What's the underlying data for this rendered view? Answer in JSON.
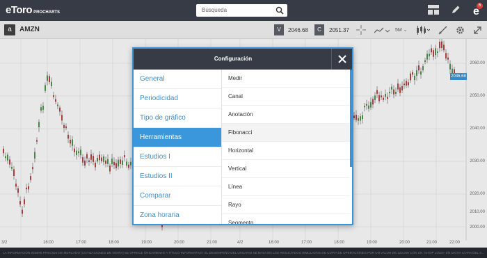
{
  "app": {
    "logo": "eToro",
    "logo_sub": "PROCHARTS"
  },
  "search": {
    "placeholder": "Búsqueda"
  },
  "notifications": {
    "count": "6"
  },
  "symbol": {
    "badge": "a",
    "name": "AMZN",
    "bid_label": "V",
    "bid": "2046.68",
    "ask_label": "C",
    "ask": "2051.37",
    "interval": "5M"
  },
  "chart": {
    "y_labels": [
      "2060.00",
      "2050.00",
      "2040.00",
      "2030.00",
      "2020.00",
      "2010.00",
      "2000.00"
    ],
    "price_tag": "2046.68",
    "x_labels": [
      "3/2",
      "16:00",
      "17:00",
      "18:00",
      "19:00",
      "20:00",
      "21:00",
      "4/2",
      "16:00",
      "17:00",
      "18:00",
      "19:00",
      "20:00",
      "21:00",
      "22:00"
    ]
  },
  "footer": {
    "disclaimer": "LA INFORMACIÓN SOBRE PRECIOS DE MERCADO (COTIZACIONES DE VENTA) SE OFRECE ÚNICAMENTE A TÍTULO INFORMATIVO. EL DESEMPEÑO DEL USUARIO SE BASA EN LOS RESULTADOS SIMULADOS DE COPIA DE OPERACIONES POR UN VALOR DE 122,000 CON UN «STOP LOSS» EN DICHA COPIA DEL 4..."
  },
  "modal": {
    "title": "Configuración",
    "categories": [
      "General",
      "Periodicidad",
      "Tipo de gráfico",
      "Herramientas",
      "Estudios I",
      "Estudios II",
      "Comparar",
      "Zona horaria"
    ],
    "tools": [
      "Medir",
      "Canal",
      "Anotación",
      "Fibonacci",
      "Horizontal",
      "Vertical",
      "Línea",
      "Rayo",
      "Segmento"
    ]
  },
  "colors": {
    "accent": "#3b97dc",
    "bull": "#4a8c4a",
    "bear": "#b04040",
    "topbar": "#363b45"
  }
}
